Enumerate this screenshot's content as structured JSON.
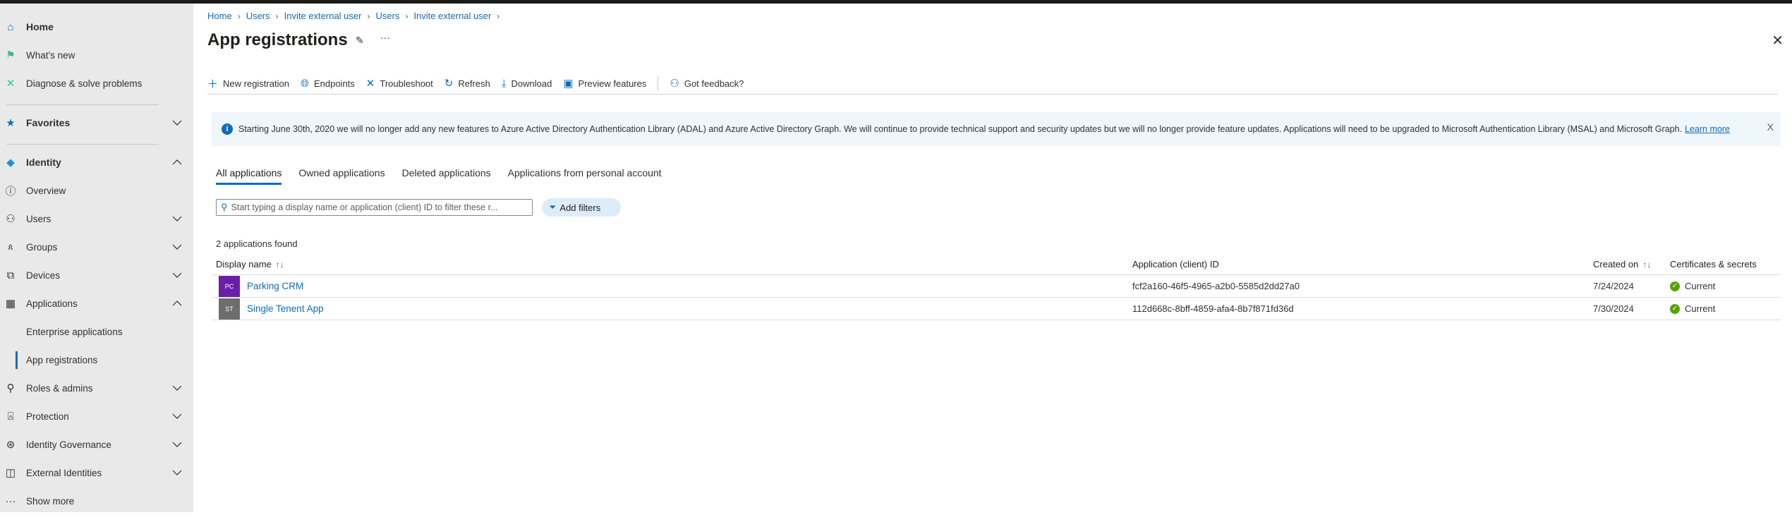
{
  "sidebar": {
    "items": [
      {
        "label": "Home",
        "icon": "home-icon"
      },
      {
        "label": "What's new",
        "icon": "megaphone-icon"
      },
      {
        "label": "Diagnose & solve problems",
        "icon": "wrench-icon"
      },
      {
        "label": "Favorites",
        "icon": "star-icon"
      },
      {
        "label": "Identity",
        "icon": "identity-diamond-icon"
      },
      {
        "label": "Overview",
        "icon": "info-icon"
      },
      {
        "label": "Users",
        "icon": "user-icon"
      },
      {
        "label": "Groups",
        "icon": "groups-icon"
      },
      {
        "label": "Devices",
        "icon": "devices-icon"
      },
      {
        "label": "Applications",
        "icon": "applications-icon"
      },
      {
        "label": "Enterprise applications"
      },
      {
        "label": "App registrations"
      },
      {
        "label": "Roles & admins",
        "icon": "roles-icon"
      },
      {
        "label": "Protection",
        "icon": "lock-icon"
      },
      {
        "label": "Identity Governance",
        "icon": "governance-icon"
      },
      {
        "label": "External Identities",
        "icon": "external-identities-icon"
      },
      {
        "label": "Show more",
        "icon": "ellipsis-icon"
      }
    ]
  },
  "breadcrumb": [
    "Home",
    "Users",
    "Invite external user",
    "Users",
    "Invite external user"
  ],
  "header": {
    "title": "App registrations",
    "more": "···",
    "close": "✕"
  },
  "toolbar": {
    "new_registration": "New registration",
    "endpoints": "Endpoints",
    "troubleshoot": "Troubleshoot",
    "refresh": "Refresh",
    "download": "Download",
    "preview_features": "Preview features",
    "feedback": "Got feedback?"
  },
  "banner": {
    "text": "Starting June 30th, 2020 we will no longer add any new features to Azure Active Directory Authentication Library (ADAL) and Azure Active Directory Graph. We will continue to provide technical support and security updates but we will no longer provide feature updates. Applications will need to be upgraded to Microsoft Authentication Library (MSAL) and Microsoft Graph.",
    "link": "Learn more",
    "close": "X"
  },
  "tabs": [
    "All applications",
    "Owned applications",
    "Deleted applications",
    "Applications from personal account"
  ],
  "active_tab": "All applications",
  "search": {
    "placeholder": "Start typing a display name or application (client) ID to filter these r...",
    "value": ""
  },
  "add_filters": "Add filters",
  "count": "2 applications found",
  "table": {
    "columns": [
      "Display name",
      "Application (client) ID",
      "Created on",
      "Certificates & secrets"
    ],
    "rows": [
      {
        "initials": "PC",
        "color": "#6b1fa8",
        "name": "Parking CRM",
        "client_id": "fcf2a160-46f5-4965-a2b0-5585d2dd27a0",
        "created": "7/24/2024",
        "certs": "Current"
      },
      {
        "initials": "ST",
        "color": "#6e6e6e",
        "name": "Single Tenent App",
        "client_id": "112d668c-8bff-4859-afa4-8b7f871fd36d",
        "created": "7/30/2024",
        "certs": "Current"
      }
    ]
  },
  "colors": {
    "accent": "#0f6cbd",
    "success": "#57a300",
    "banner_bg": "#eff6fc",
    "sidebar_bg": "#e9e9e9"
  }
}
